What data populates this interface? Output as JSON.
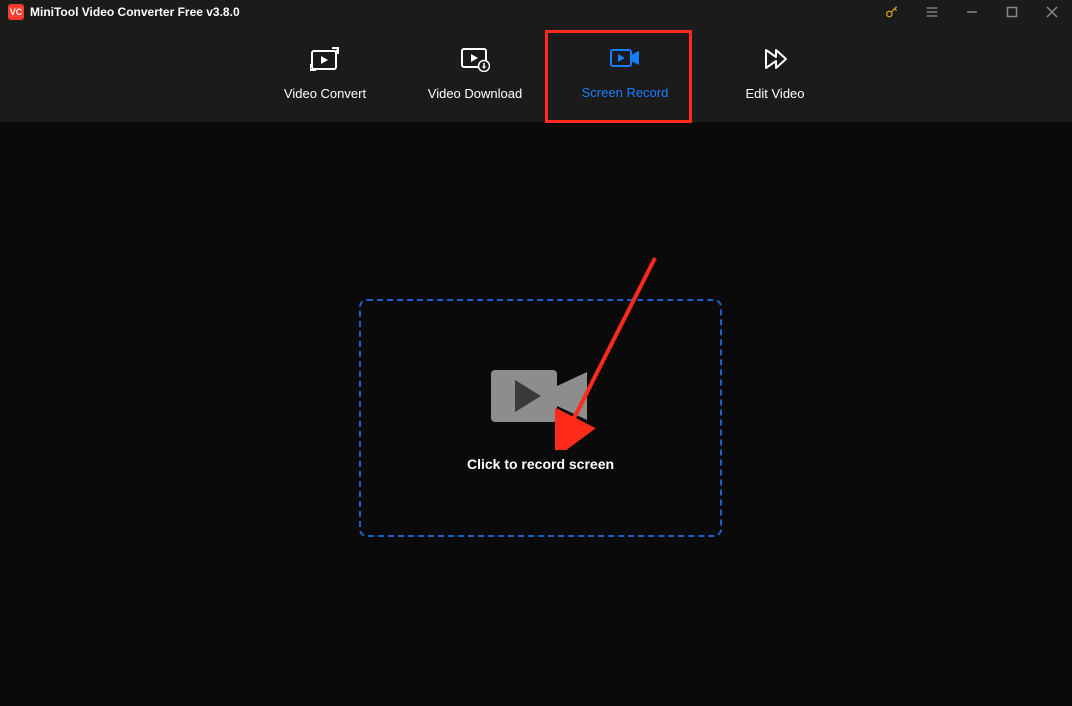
{
  "titlebar": {
    "app_name": "MiniTool Video Converter Free v3.8.0"
  },
  "tabs": {
    "video_convert": "Video Convert",
    "video_download": "Video Download",
    "screen_record": "Screen Record",
    "edit_video": "Edit Video"
  },
  "main": {
    "record_cta": "Click to record screen"
  },
  "colors": {
    "accent_blue": "#197dff",
    "highlight_red": "#ff2a1a",
    "dashed_blue": "#1f5fc9"
  }
}
